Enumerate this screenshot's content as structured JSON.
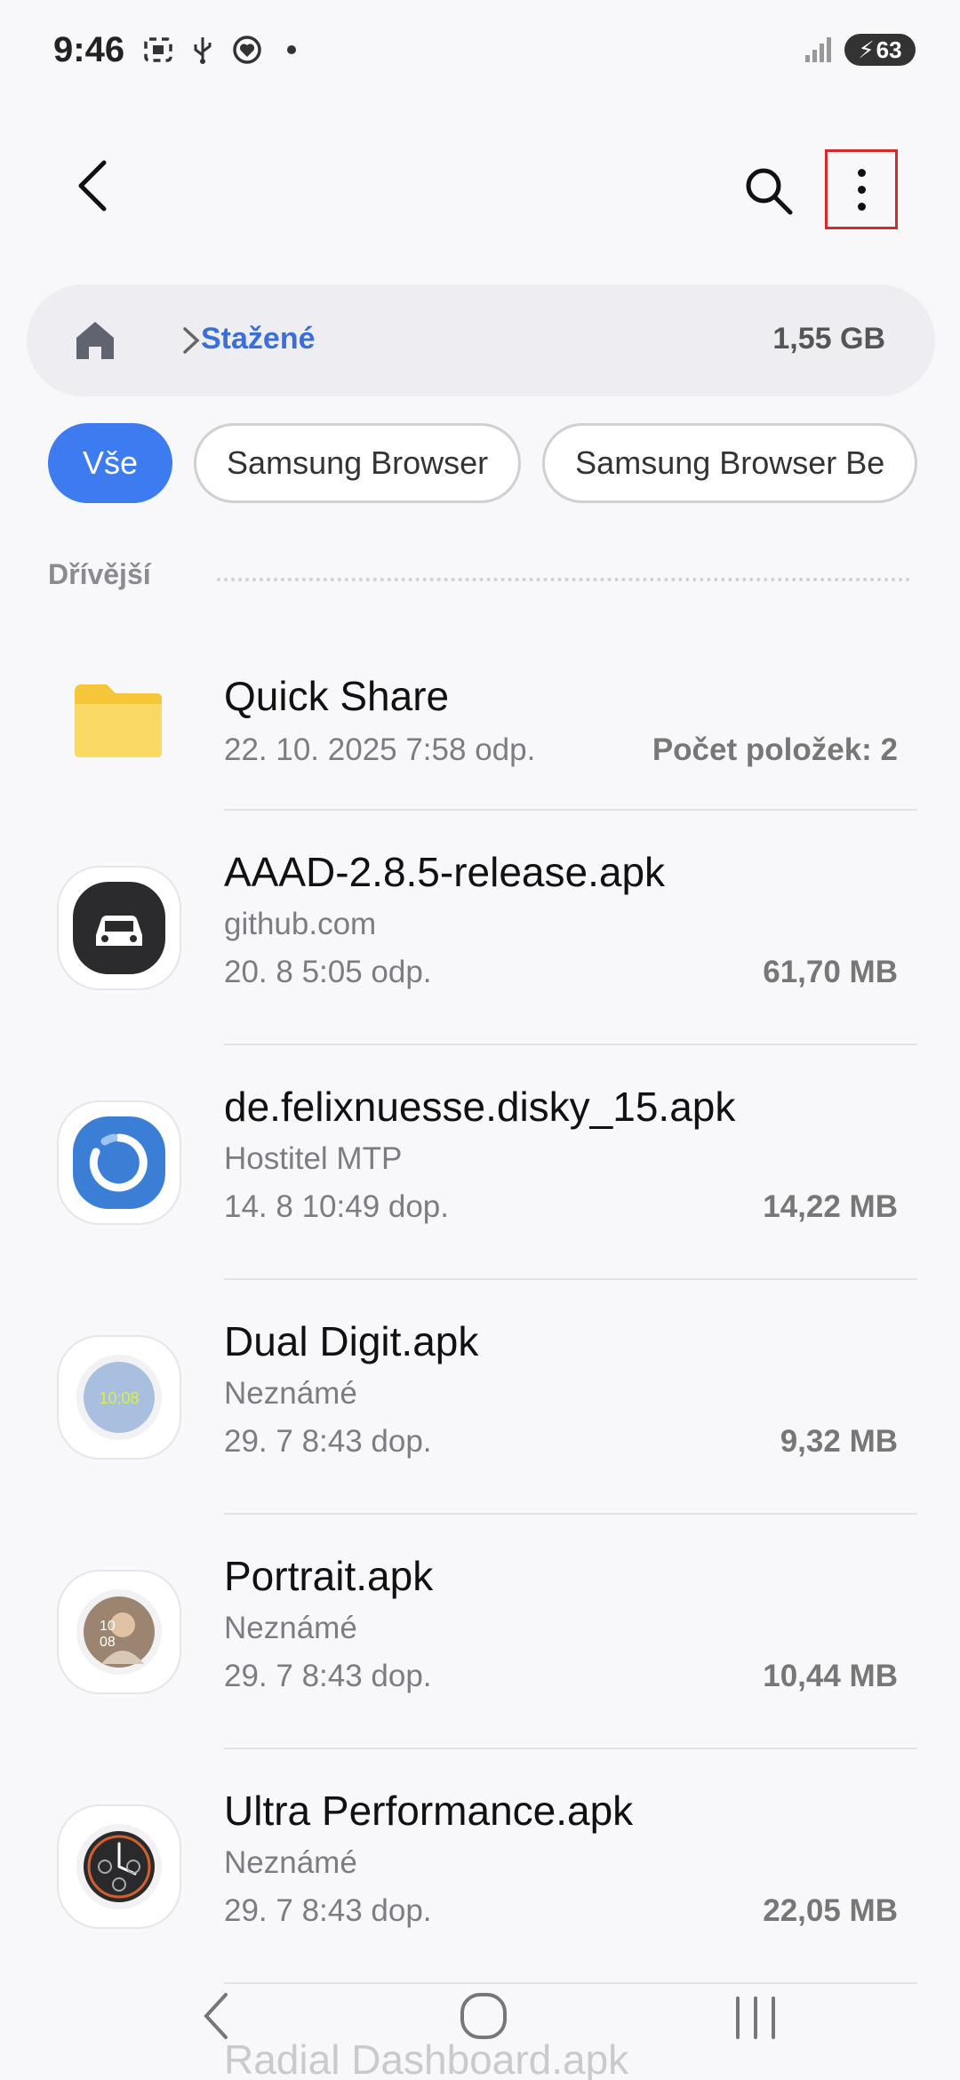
{
  "status": {
    "time": "9:46",
    "battery": "63",
    "icons": [
      "screenshot-icon",
      "usb-icon",
      "health-icon",
      "dot-icon"
    ]
  },
  "appbar": {
    "back_icon": "back-arrow-icon",
    "search_icon": "search-icon",
    "more_icon": "more-vert-icon"
  },
  "path": {
    "folder": "Stažené",
    "size": "1,55 GB"
  },
  "chips": [
    "Vše",
    "Samsung Browser",
    "Samsung Browser Be"
  ],
  "section": {
    "label": "Dřívější"
  },
  "items": [
    {
      "name": "Quick Share",
      "source": "",
      "date": "22. 10. 2025 7:58 odp.",
      "right": "Počet položek: 2",
      "icon": "folder-icon"
    },
    {
      "name": "AAAD-2.8.5-release.apk",
      "source": "github.com",
      "date": "20. 8 5:05 odp.",
      "right": "61,70 MB",
      "icon": "car-app-icon"
    },
    {
      "name": "de.felixnuesse.disky_15.apk",
      "source": "Hostitel MTP",
      "date": "14. 8 10:49 dop.",
      "right": "14,22 MB",
      "icon": "disky-app-icon"
    },
    {
      "name": "Dual Digit.apk",
      "source": "Neznámé",
      "date": "29. 7 8:43 dop.",
      "right": "9,32 MB",
      "icon": "watchface-dual-digit-icon"
    },
    {
      "name": "Portrait.apk",
      "source": "Neznámé",
      "date": "29. 7 8:43 dop.",
      "right": "10,44 MB",
      "icon": "watchface-portrait-icon"
    },
    {
      "name": "Ultra Performance.apk",
      "source": "Neznámé",
      "date": "29. 7 8:43 dop.",
      "right": "22,05 MB",
      "icon": "watchface-ultra-icon"
    }
  ],
  "partial_item": "Radial Dashboard.apk",
  "navbar": {
    "icons": [
      "nav-back-icon",
      "nav-home-icon",
      "nav-recents-icon"
    ]
  },
  "colors": {
    "accent": "#3d7bf0",
    "path_folder": "#3a6fd8",
    "highlight_border": "#d62a2a",
    "folder_yellow": "#f7cf4a"
  }
}
